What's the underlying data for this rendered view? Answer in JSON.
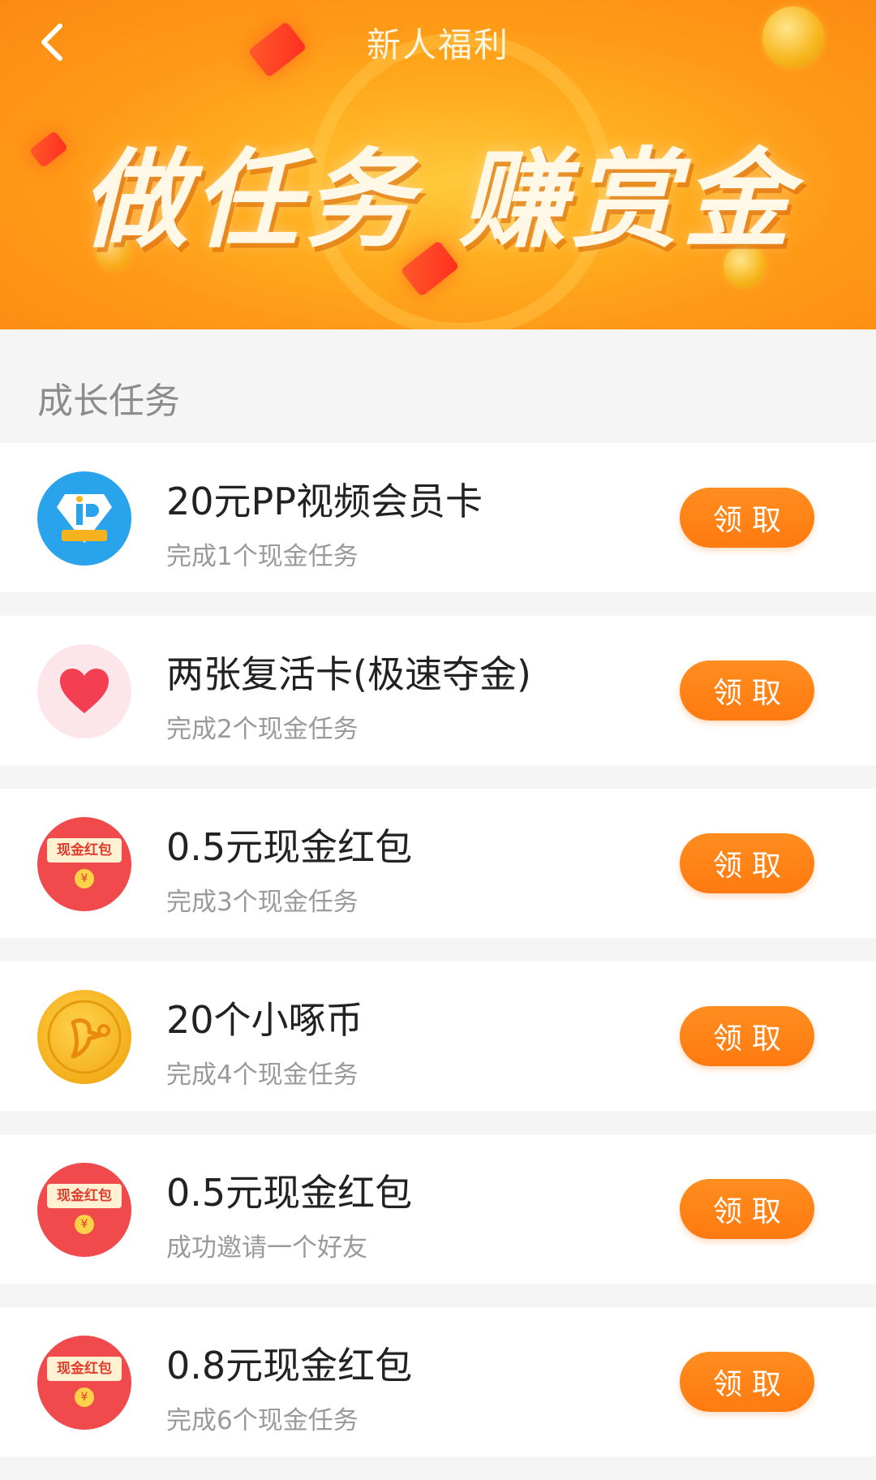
{
  "header": {
    "title": "新人福利",
    "hero_text": "做任务 赚赏金"
  },
  "section": {
    "title": "成长任务"
  },
  "tasks": [
    {
      "title": "20元PP视频会员卡",
      "subtitle": "完成1个现金任务",
      "button": "领取",
      "icon": "pp-video-icon"
    },
    {
      "title": "两张复活卡(极速夺金)",
      "subtitle": "完成2个现金任务",
      "button": "领取",
      "icon": "heart-icon"
    },
    {
      "title": "0.5元现金红包",
      "subtitle": "完成3个现金任务",
      "button": "领取",
      "icon": "red-envelope-icon"
    },
    {
      "title": "20个小啄币",
      "subtitle": "完成4个现金任务",
      "button": "领取",
      "icon": "woodpecker-coin-icon"
    },
    {
      "title": "0.5元现金红包",
      "subtitle": "成功邀请一个好友",
      "button": "领取",
      "icon": "red-envelope-icon"
    },
    {
      "title": "0.8元现金红包",
      "subtitle": "完成6个现金任务",
      "button": "领取",
      "icon": "red-envelope-icon"
    }
  ],
  "icon_text": {
    "red_envelope_label": "现金红包",
    "yuan_symbol": "¥"
  },
  "colors": {
    "accent": "#ff8118",
    "banner": "#ffa41b"
  }
}
